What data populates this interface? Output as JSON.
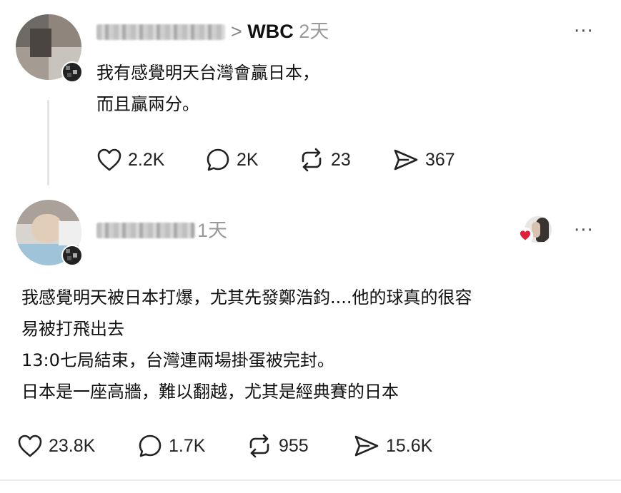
{
  "posts": [
    {
      "topic": "WBC",
      "separator": ">",
      "time": "2天",
      "more": "···",
      "content": "我有感覺明天台灣會贏日本，\n而且贏兩分。",
      "likes": "2.2K",
      "replies": "2K",
      "reposts": "23",
      "shares": "367"
    },
    {
      "time": "1天",
      "more": "···",
      "content": "我感覺明天被日本打爆，尤其先發鄭浩鈞....他的球真的很容\n易被打飛出去\n13:0七局結束，台灣連兩場掛蛋被完封。\n日本是一座高牆，難以翻越，尤其是經典賽的日本",
      "likes": "23.8K",
      "replies": "1.7K",
      "reposts": "955",
      "shares": "15.6K"
    }
  ],
  "icons": {
    "like": "heart-icon",
    "reply": "comment-bubble-icon",
    "repost": "repost-icon",
    "share": "send-icon",
    "liked_badge": "red-heart-icon"
  },
  "colors": {
    "text": "#111111",
    "muted": "#999999",
    "icon": "#222222",
    "divider": "#ececec",
    "heart_red": "#e0203a"
  }
}
